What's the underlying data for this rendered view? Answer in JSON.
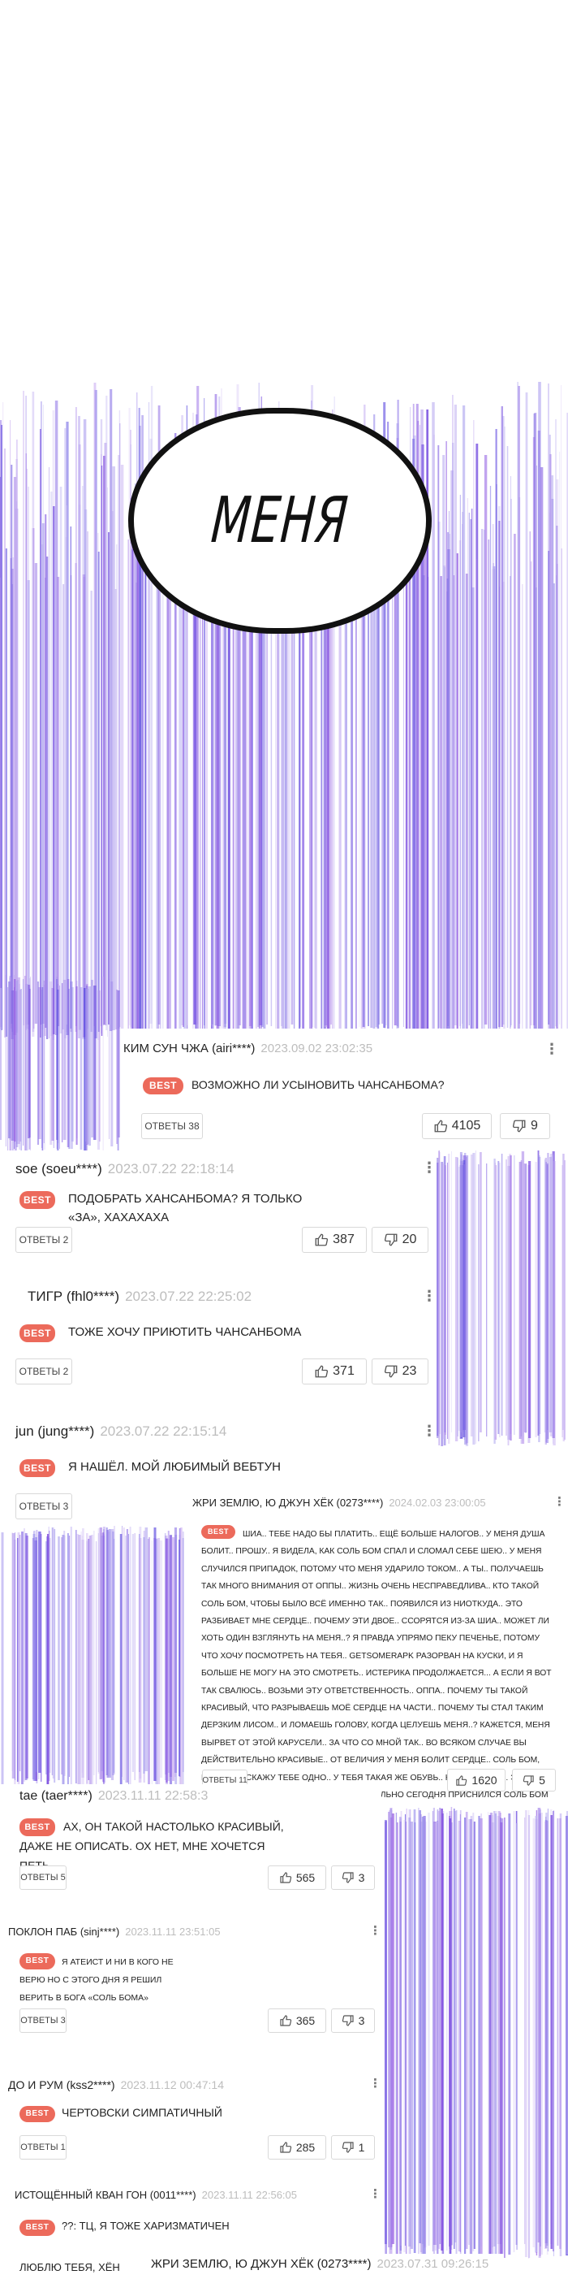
{
  "bubble_text": "МЕНЯ",
  "icons": {
    "more": "more-vertical-icon",
    "like": "thumbs-up-icon",
    "dislike": "thumbs-down-icon"
  },
  "colors": {
    "best_badge": "#ec6a5b",
    "date_text": "#bdbdbd",
    "speed_lines": "#8f84e6"
  },
  "comments": [
    {
      "author": "КИМ СУН ЧЖА (airi****)",
      "date": "2023.09.02 23:02:35",
      "badge": "BEST",
      "text": "ВОЗМОЖНО ЛИ УСЫНОВИТЬ ЧАНСАНБОМА?",
      "replies": "ОТВЕТЫ 38",
      "likes": "4105",
      "dislikes": "9"
    },
    {
      "author": "soe (soeu****)",
      "date": "2023.07.22 22:18:14",
      "badge": "BEST",
      "text": "ПОДОБРАТЬ ХАНСАНБОМА? Я ТОЛЬКО «ЗА», ХАХАХАХА",
      "replies": "ОТВЕТЫ 2",
      "likes": "387",
      "dislikes": "20"
    },
    {
      "author": "ТИГР (fhl0****)",
      "date": "2023.07.22 22:25:02",
      "badge": "BEST",
      "text": "ТОЖЕ ХОЧУ ПРИЮТИТЬ ЧАНСАНБОМА",
      "replies": "ОТВЕТЫ 2",
      "likes": "371",
      "dislikes": "23"
    },
    {
      "author": "jun (jung****)",
      "date": "2023.07.22 22:15:14",
      "badge": "BEST",
      "text": "Я НАШЁЛ. МОЙ ЛЮБИМЫЙ ВЕБТУН",
      "replies": "ОТВЕТЫ 3"
    },
    {
      "author": "ЖРИ ЗЕМЛЮ, Ю ДЖУН ХЁК (0273****)",
      "date": "2024.02.03 23:00:05",
      "badge": "BEST",
      "text": "ШИА.. ТЕБЕ НАДО БЫ ПЛАТИТЬ.. ЕЩЁ БОЛЬШЕ НАЛОГОВ.. У МЕНЯ ДУША БОЛИТ.. ПРОШУ.. Я ВИДЕЛА, КАК СОЛЬ БОМ СПАЛ И СЛОМАЛ СЕБЕ ШЕЮ.. У МЕНЯ СЛУЧИЛСЯ ПРИПАДОК, ПОТОМУ ЧТО МЕНЯ УДАРИЛО ТОКОМ.. А ТЫ.. ПОЛУЧАЕШЬ ТАК МНОГО ВНИМАНИЯ ОТ ОППЫ.. ЖИЗНЬ ОЧЕНЬ НЕСПРАВЕДЛИВА.. КТО ТАКОЙ СОЛЬ БОМ, ЧТОБЫ БЫЛО ВСЁ ИМЕННО ТАК.. ПОЯВИЛСЯ ИЗ НИОТКУДА.. ЭТО РАЗБИВАЕТ МНЕ СЕРДЦЕ.. ПОЧЕМУ ЭТИ ДВОЕ.. ССОРЯТСЯ ИЗ-ЗА ШИА.. МОЖЕТ ЛИ ХОТЬ ОДИН ВЗГЛЯНУТЬ НА МЕНЯ..? Я ПРАВДА УПРЯМО ПЕКУ ПЕЧЕНЬЕ, ПОТОМУ ЧТО ХОЧУ ПОСМОТРЕТЬ НА ТЕБЯ.. GETSOMERAPK РАЗОРВАН НА КУСКИ, И Я БОЛЬШЕ НЕ МОГУ НА ЭТО СМОТРЕТЬ.. ИСТЕРИКА ПРОДОЛЖАЕТСЯ... А ЕСЛИ Я ВОТ ТАК СВАЛЮСЬ.. ВОЗЬМИ ЭТУ ОТВЕТСТВЕННОСТЬ.. ОППА.. ПОЧЕМУ ТЫ ТАКОЙ КРАСИВЫЙ, ЧТО РАЗРЫВАЕШЬ МОЁ СЕРДЦЕ НА ЧАСТИ.. ПОЧЕМУ ТЫ СТАЛ ТАКИМ ДЕРЗКИМ ЛИСОМ.. И ЛОМАЕШЬ ГОЛОВУ, КОГДА ЦЕЛУЕШЬ МЕНЯ..? КАЖЕТСЯ, МЕНЯ ВЫРВЕТ ОТ ЭТОЙ КАРУСЕЛИ.. ЗА ЧТО СО МНОЙ ТАК.. ВО ВСЯКОМ СЛУЧАЕ ВЫ ДЕЙСТВИТЕЛЬНО КРАСИВЫЕ.. ОТ ВЕЛИЧИЯ У МЕНЯ БОЛИТ СЕРДЦЕ.. СОЛЬ БОМ, ПРИДИ.. Я СКАЖУ ТЕБЕ ОДНО.. У ТЕБЯ ТАКАЯ ЖЕ ОБУВЬ.. КАК И У МЕНЯ.. ЭТО СУДЬБА, НЕ ТАК ЛИ..? ЭХ, МНЕ ДЕЙСТВИТЕЛЬНО СЕГОДНЯ ПРИСНИЛСЯ СОЛЬ БОМ",
      "replies": "ОТВЕТЫ 11",
      "likes": "1620",
      "dislikes": "5"
    },
    {
      "author": "tae (taer****)",
      "date": "2023.11.11 22:58:3",
      "badge": "BEST",
      "text": "АХ, ОН ТАКОЙ НАСТОЛЬКО КРАСИВЫЙ, ДАЖЕ НЕ ОПИСАТЬ. ОХ НЕТ, МНЕ ХОЧЕТСЯ ПЕТЬ",
      "replies": "ОТВЕТЫ 5",
      "likes": "565",
      "dislikes": "3"
    },
    {
      "author": "ПОКЛОН ПАБ (sinj****)",
      "date": "2023.11.11 23:51:05",
      "badge": "BEST",
      "text": "Я АТЕИСТ И НИ В КОГО НЕ ВЕРЮ НО С ЭТОГО ДНЯ Я РЕШИЛ ВЕРИТЬ В БОГА «СОЛЬ БОМА»",
      "replies": "ОТВЕТЫ 3",
      "likes": "365",
      "dislikes": "3"
    },
    {
      "author": "ДО И РУМ (kss2****)",
      "date": "2023.11.12 00:47:14",
      "badge": "BEST",
      "text": "ЧЕРТОВСКИ СИМПАТИЧНЫЙ",
      "replies": "ОТВЕТЫ 1",
      "likes": "285",
      "dislikes": "1"
    },
    {
      "author": "ИСТОЩЁННЫЙ КВАН ГОН (0011****)",
      "date": "2023.11.11 22:56:05",
      "badge": "BEST",
      "text": "??: ТЦ, Я ТОЖЕ ХАРИЗМАТИЧЕН"
    },
    {
      "text": "ЛЮБЛЮ ТЕБЯ, ХЁН"
    },
    {
      "author": "ЖРИ ЗЕМЛЮ, Ю ДЖУН ХЁК (0273****)",
      "date": "2023.07.31 09:26:15"
    }
  ]
}
